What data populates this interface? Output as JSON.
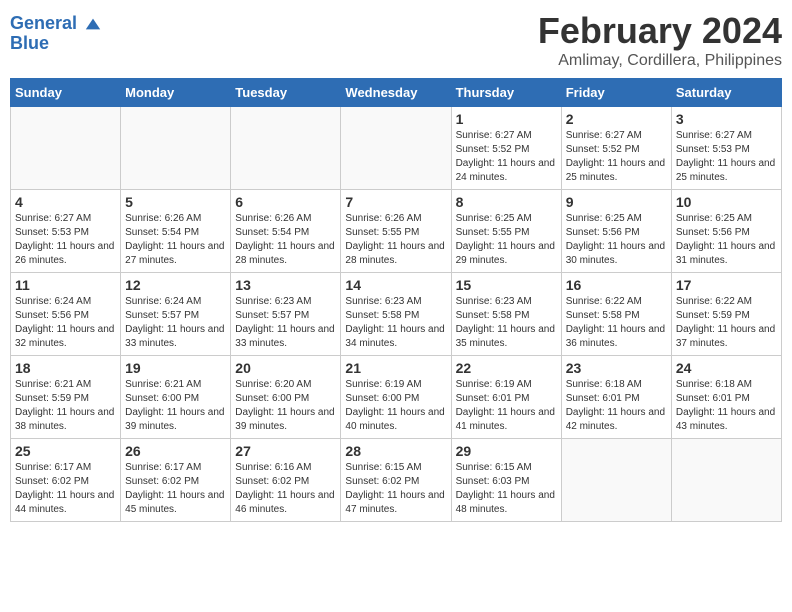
{
  "header": {
    "logo_line1": "General",
    "logo_line2": "Blue",
    "title": "February 2024",
    "subtitle": "Amlimay, Cordillera, Philippines"
  },
  "weekdays": [
    "Sunday",
    "Monday",
    "Tuesday",
    "Wednesday",
    "Thursday",
    "Friday",
    "Saturday"
  ],
  "weeks": [
    [
      {
        "day": "",
        "info": ""
      },
      {
        "day": "",
        "info": ""
      },
      {
        "day": "",
        "info": ""
      },
      {
        "day": "",
        "info": ""
      },
      {
        "day": "1",
        "info": "Sunrise: 6:27 AM\nSunset: 5:52 PM\nDaylight: 11 hours and 24 minutes."
      },
      {
        "day": "2",
        "info": "Sunrise: 6:27 AM\nSunset: 5:52 PM\nDaylight: 11 hours and 25 minutes."
      },
      {
        "day": "3",
        "info": "Sunrise: 6:27 AM\nSunset: 5:53 PM\nDaylight: 11 hours and 25 minutes."
      }
    ],
    [
      {
        "day": "4",
        "info": "Sunrise: 6:27 AM\nSunset: 5:53 PM\nDaylight: 11 hours and 26 minutes."
      },
      {
        "day": "5",
        "info": "Sunrise: 6:26 AM\nSunset: 5:54 PM\nDaylight: 11 hours and 27 minutes."
      },
      {
        "day": "6",
        "info": "Sunrise: 6:26 AM\nSunset: 5:54 PM\nDaylight: 11 hours and 28 minutes."
      },
      {
        "day": "7",
        "info": "Sunrise: 6:26 AM\nSunset: 5:55 PM\nDaylight: 11 hours and 28 minutes."
      },
      {
        "day": "8",
        "info": "Sunrise: 6:25 AM\nSunset: 5:55 PM\nDaylight: 11 hours and 29 minutes."
      },
      {
        "day": "9",
        "info": "Sunrise: 6:25 AM\nSunset: 5:56 PM\nDaylight: 11 hours and 30 minutes."
      },
      {
        "day": "10",
        "info": "Sunrise: 6:25 AM\nSunset: 5:56 PM\nDaylight: 11 hours and 31 minutes."
      }
    ],
    [
      {
        "day": "11",
        "info": "Sunrise: 6:24 AM\nSunset: 5:56 PM\nDaylight: 11 hours and 32 minutes."
      },
      {
        "day": "12",
        "info": "Sunrise: 6:24 AM\nSunset: 5:57 PM\nDaylight: 11 hours and 33 minutes."
      },
      {
        "day": "13",
        "info": "Sunrise: 6:23 AM\nSunset: 5:57 PM\nDaylight: 11 hours and 33 minutes."
      },
      {
        "day": "14",
        "info": "Sunrise: 6:23 AM\nSunset: 5:58 PM\nDaylight: 11 hours and 34 minutes."
      },
      {
        "day": "15",
        "info": "Sunrise: 6:23 AM\nSunset: 5:58 PM\nDaylight: 11 hours and 35 minutes."
      },
      {
        "day": "16",
        "info": "Sunrise: 6:22 AM\nSunset: 5:58 PM\nDaylight: 11 hours and 36 minutes."
      },
      {
        "day": "17",
        "info": "Sunrise: 6:22 AM\nSunset: 5:59 PM\nDaylight: 11 hours and 37 minutes."
      }
    ],
    [
      {
        "day": "18",
        "info": "Sunrise: 6:21 AM\nSunset: 5:59 PM\nDaylight: 11 hours and 38 minutes."
      },
      {
        "day": "19",
        "info": "Sunrise: 6:21 AM\nSunset: 6:00 PM\nDaylight: 11 hours and 39 minutes."
      },
      {
        "day": "20",
        "info": "Sunrise: 6:20 AM\nSunset: 6:00 PM\nDaylight: 11 hours and 39 minutes."
      },
      {
        "day": "21",
        "info": "Sunrise: 6:19 AM\nSunset: 6:00 PM\nDaylight: 11 hours and 40 minutes."
      },
      {
        "day": "22",
        "info": "Sunrise: 6:19 AM\nSunset: 6:01 PM\nDaylight: 11 hours and 41 minutes."
      },
      {
        "day": "23",
        "info": "Sunrise: 6:18 AM\nSunset: 6:01 PM\nDaylight: 11 hours and 42 minutes."
      },
      {
        "day": "24",
        "info": "Sunrise: 6:18 AM\nSunset: 6:01 PM\nDaylight: 11 hours and 43 minutes."
      }
    ],
    [
      {
        "day": "25",
        "info": "Sunrise: 6:17 AM\nSunset: 6:02 PM\nDaylight: 11 hours and 44 minutes."
      },
      {
        "day": "26",
        "info": "Sunrise: 6:17 AM\nSunset: 6:02 PM\nDaylight: 11 hours and 45 minutes."
      },
      {
        "day": "27",
        "info": "Sunrise: 6:16 AM\nSunset: 6:02 PM\nDaylight: 11 hours and 46 minutes."
      },
      {
        "day": "28",
        "info": "Sunrise: 6:15 AM\nSunset: 6:02 PM\nDaylight: 11 hours and 47 minutes."
      },
      {
        "day": "29",
        "info": "Sunrise: 6:15 AM\nSunset: 6:03 PM\nDaylight: 11 hours and 48 minutes."
      },
      {
        "day": "",
        "info": ""
      },
      {
        "day": "",
        "info": ""
      }
    ]
  ]
}
